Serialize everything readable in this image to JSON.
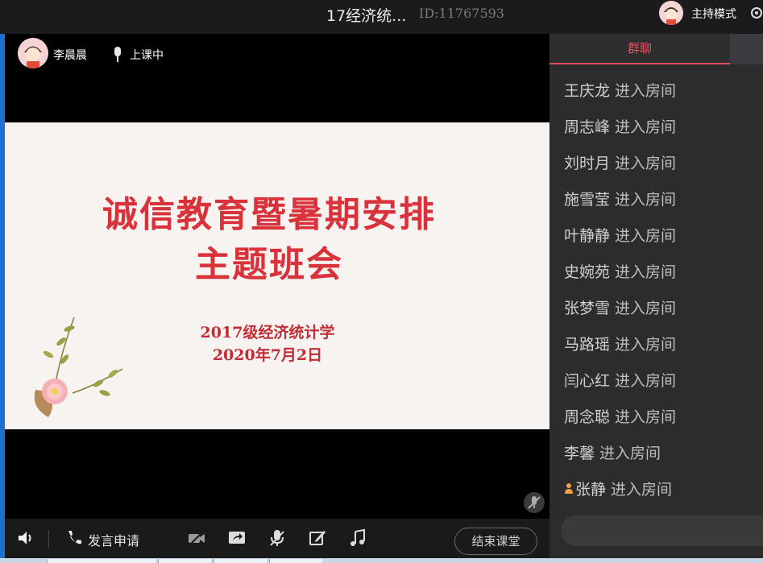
{
  "header": {
    "title": "17经济统...",
    "room_id": "ID:11767593",
    "mode_label": "主持模式"
  },
  "stage": {
    "teacher_name": "李晨晨",
    "status": "上课中",
    "slide": {
      "title_line1": "诚信教育暨暑期安排",
      "title_line2": "主题班会",
      "subtitle_line1": "2017级经济统计学",
      "subtitle_line2": "2020年7月2日"
    }
  },
  "toolbar": {
    "apply_label": "发言申请",
    "end_class_label": "结束课堂"
  },
  "chat": {
    "tab_label": "群聊",
    "messages": [
      {
        "name": "王庆龙",
        "text": " 进入房间"
      },
      {
        "name": "周志峰",
        "text": " 进入房间"
      },
      {
        "name": "刘时月",
        "text": " 进入房间"
      },
      {
        "name": "施雪莹",
        "text": " 进入房间"
      },
      {
        "name": "叶静静",
        "text": " 进入房间"
      },
      {
        "name": "史婉苑",
        "text": " 进入房间"
      },
      {
        "name": "张梦雪",
        "text": " 进入房间"
      },
      {
        "name": "马路瑶",
        "text": " 进入房间"
      },
      {
        "name": "闫心红",
        "text": " 进入房间"
      },
      {
        "name": "周念聪",
        "text": " 进入房间"
      },
      {
        "name": "李馨",
        "text": " 进入房间"
      },
      {
        "name": "张静",
        "text": " 进入房间"
      }
    ]
  },
  "colors": {
    "accent": "#e04f5f",
    "slide_title": "#d9323a",
    "panel_bg": "#2c2c2c"
  },
  "icons": [
    "gear-icon",
    "mic-icon",
    "speaker-icon",
    "phone-icon",
    "camera-off-icon",
    "screen-share-icon",
    "mic-off-icon",
    "edit-icon",
    "music-icon",
    "user-badge-icon"
  ]
}
